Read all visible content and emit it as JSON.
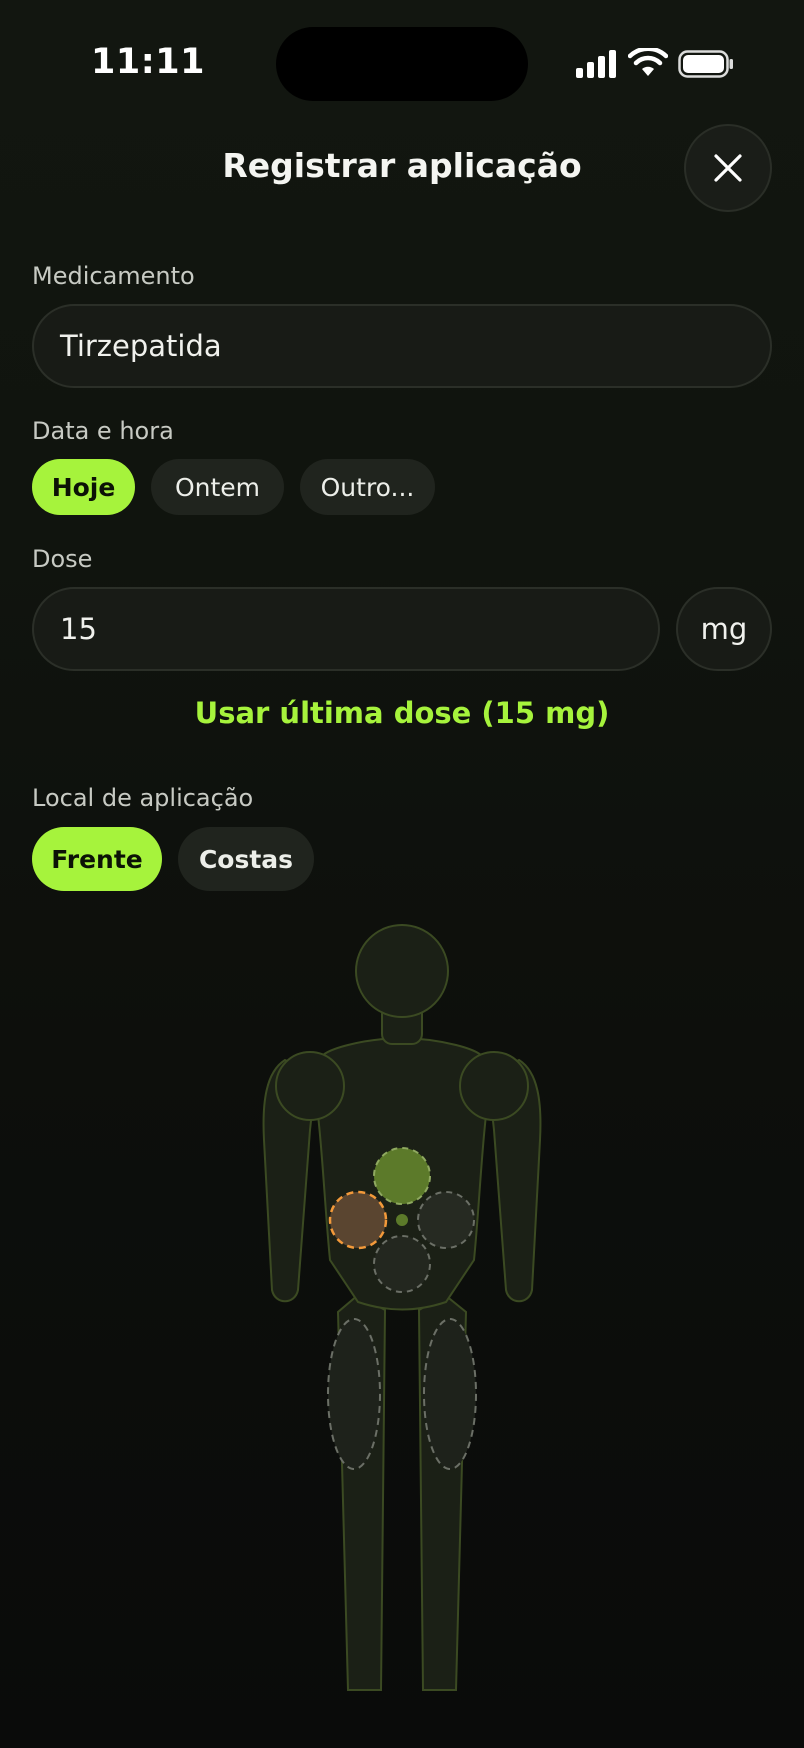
{
  "status_bar": {
    "time": "11:11"
  },
  "header": {
    "title": "Registrar aplicação"
  },
  "medication": {
    "label": "Medicamento",
    "value": "Tirzepatida"
  },
  "datetime": {
    "label": "Data e hora",
    "options": [
      {
        "label": "Hoje",
        "selected": true
      },
      {
        "label": "Ontem",
        "selected": false
      },
      {
        "label": "Outro...",
        "selected": false
      }
    ]
  },
  "dose": {
    "label": "Dose",
    "value": "15",
    "unit": "mg",
    "last_dose_link": "Usar última dose (15 mg)"
  },
  "site": {
    "label": "Local de aplicação",
    "options": [
      {
        "label": "Frente",
        "selected": true
      },
      {
        "label": "Costas",
        "selected": false
      }
    ]
  },
  "colors": {
    "accent": "#a6f33c",
    "warning": "#f2993a",
    "background": "#0c0d0c"
  },
  "icons": {
    "close": "close-icon",
    "signal": "cellular-signal-icon",
    "wifi": "wifi-icon",
    "battery": "battery-icon"
  }
}
